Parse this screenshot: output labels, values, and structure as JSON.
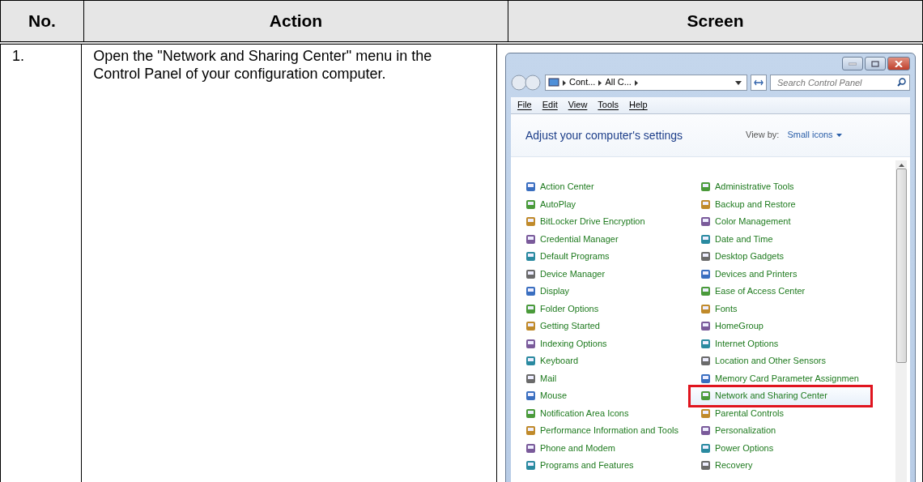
{
  "table": {
    "columns": [
      "No.",
      "Action",
      "Screen"
    ],
    "rows": [
      {
        "number": "1.",
        "action": "Open the \"Network and Sharing Center\" menu in the Control Panel of your configuration computer.",
        "screen": {
          "window": {
            "address": [
              "Cont...",
              "All C..."
            ],
            "search": {
              "placeholder": "Search Control Panel"
            },
            "menu": [
              "File",
              "Edit",
              "View",
              "Tools",
              "Help"
            ],
            "heading": "Adjust your computer's settings",
            "view_by_label": "View by:",
            "view_by_value": "Small icons",
            "left_column": [
              {
                "label": "Action Center",
                "selected": false
              },
              {
                "label": "AutoPlay",
                "selected": false
              },
              {
                "label": "BitLocker Drive Encryption",
                "selected": false
              },
              {
                "label": "Credential Manager",
                "selected": false
              },
              {
                "label": "Default Programs",
                "selected": false
              },
              {
                "label": "Device Manager",
                "selected": false
              },
              {
                "label": "Display",
                "selected": false
              },
              {
                "label": "Folder Options",
                "selected": false
              },
              {
                "label": "Getting Started",
                "selected": false
              },
              {
                "label": "Indexing Options",
                "selected": false
              },
              {
                "label": "Keyboard",
                "selected": false
              },
              {
                "label": "Mail",
                "selected": false
              },
              {
                "label": "Mouse",
                "selected": false
              },
              {
                "label": "Notification Area Icons",
                "selected": false
              },
              {
                "label": "Performance Information and Tools",
                "selected": false
              },
              {
                "label": "Phone and Modem",
                "selected": false
              },
              {
                "label": "Programs and Features",
                "selected": false
              }
            ],
            "right_column": [
              {
                "label": "Administrative Tools",
                "selected": false
              },
              {
                "label": "Backup and Restore",
                "selected": false
              },
              {
                "label": "Color Management",
                "selected": false
              },
              {
                "label": "Date and Time",
                "selected": false
              },
              {
                "label": "Desktop Gadgets",
                "selected": false
              },
              {
                "label": "Devices and Printers",
                "selected": false
              },
              {
                "label": "Ease of Access Center",
                "selected": false
              },
              {
                "label": "Fonts",
                "selected": false
              },
              {
                "label": "HomeGroup",
                "selected": false
              },
              {
                "label": "Internet Options",
                "selected": false
              },
              {
                "label": "Location and Other Sensors",
                "selected": false
              },
              {
                "label": "Memory Card Parameter Assignmen",
                "selected": false
              },
              {
                "label": "Network and Sharing Center",
                "selected": true
              },
              {
                "label": "Parental Controls",
                "selected": false
              },
              {
                "label": "Personalization",
                "selected": false
              },
              {
                "label": "Power Options",
                "selected": false
              },
              {
                "label": "Recovery",
                "selected": false
              }
            ]
          }
        }
      }
    ]
  }
}
